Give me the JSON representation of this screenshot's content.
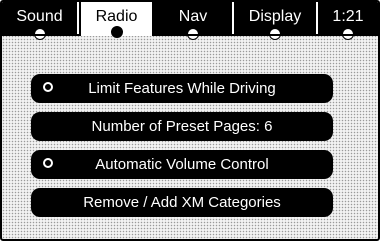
{
  "tabs": [
    {
      "label": "Sound"
    },
    {
      "label": "Radio"
    },
    {
      "label": "Nav"
    },
    {
      "label": "Display"
    },
    {
      "label": "1:21"
    }
  ],
  "active_tab": "Radio",
  "options": [
    {
      "label": "Limit Features While Driving",
      "has_radio": true
    },
    {
      "label": "Number of Preset Pages: 6",
      "has_radio": false
    },
    {
      "label": "Automatic Volume Control",
      "has_radio": true
    },
    {
      "label": "Remove / Add XM Categories",
      "has_radio": false
    }
  ]
}
